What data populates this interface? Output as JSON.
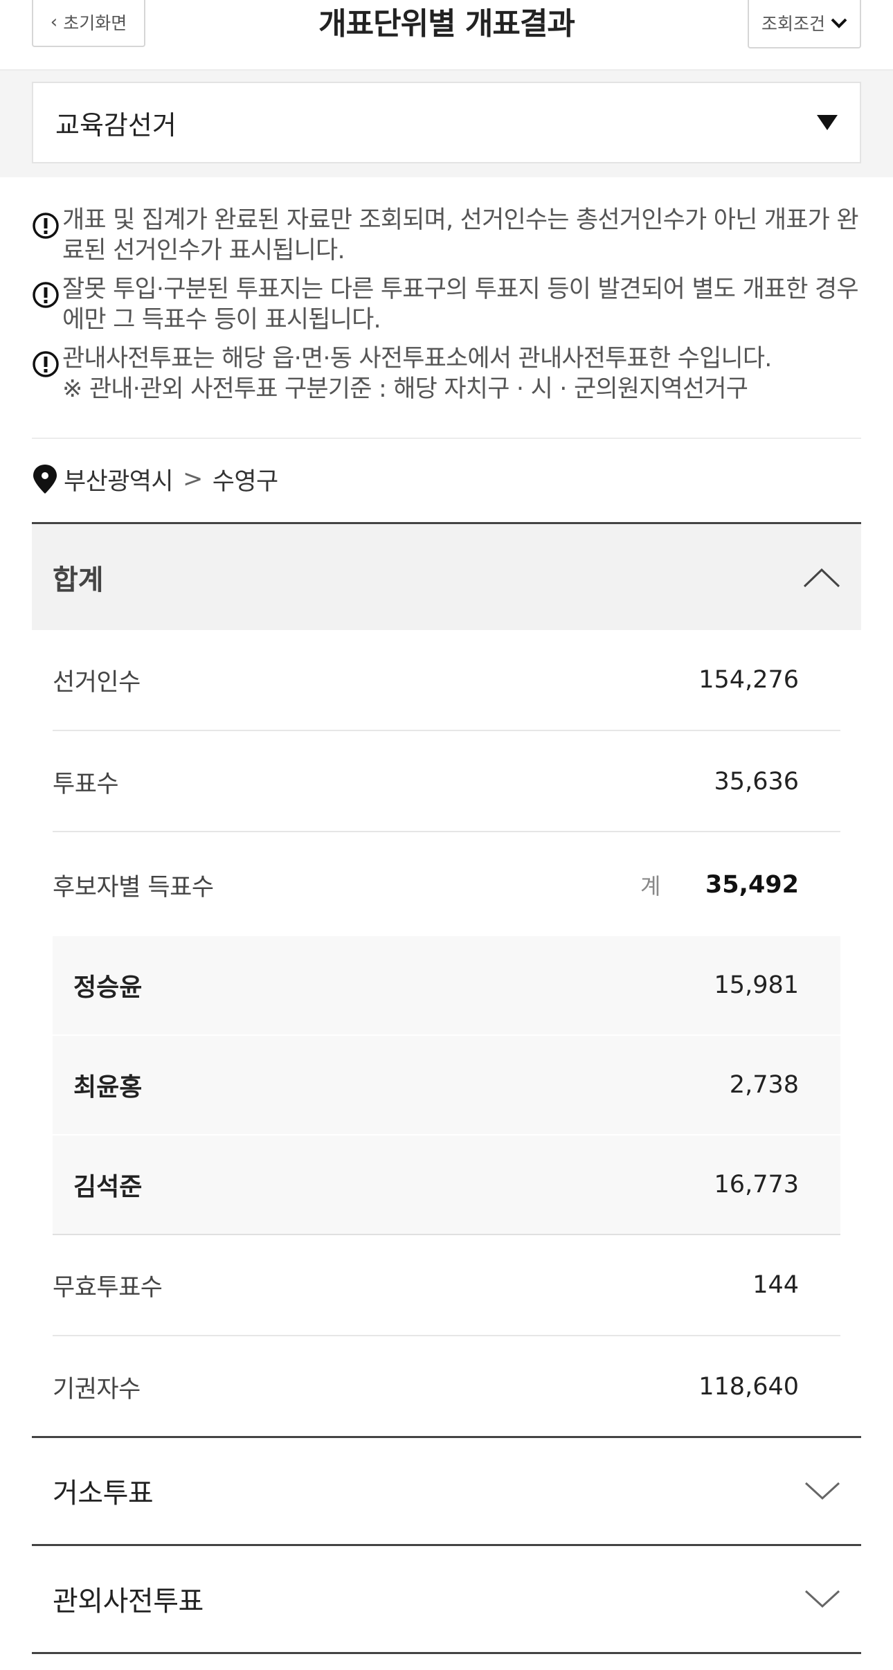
{
  "header": {
    "back_label": "초기화면",
    "title": "개표단위별 개표결과",
    "condition_label": "조회조건"
  },
  "election_select": {
    "selected": "교육감선거"
  },
  "notices": [
    "개표 및 집계가 완료된 자료만 조회되며, 선거인수는 총선거인수가 아닌 개표가 완료된 선거인수가 표시됩니다.",
    "잘못 투입·구분된 투표지는 다른 투표구의 투표지 등이 발견되어 별도 개표한 경우에만 그 득표수 등이 표시됩니다.",
    "관내사전투표는 해당 읍·면·동 사전투표소에서 관내사전투표한 수입니다.\n※ 관내·관외 사전투표 구분기준 : 해당 자치구 · 시 · 군의원지역선거구"
  ],
  "breadcrumb": {
    "region": "부산광역시",
    "separator": ">",
    "district": "수영구"
  },
  "total_section": {
    "title": "합계",
    "voters_label": "선거인수",
    "voters_value": "154,276",
    "votes_label": "투표수",
    "votes_value": "35,636",
    "candidate_votes_label": "후보자별 득표수",
    "sum_label": "계",
    "sum_value": "35,492",
    "candidates": [
      {
        "name": "정승윤",
        "votes": "15,981"
      },
      {
        "name": "최윤홍",
        "votes": "2,738"
      },
      {
        "name": "김석준",
        "votes": "16,773"
      }
    ],
    "invalid_label": "무효투표수",
    "invalid_value": "144",
    "abstain_label": "기권자수",
    "abstain_value": "118,640"
  },
  "sections": [
    {
      "title": "거소투표"
    },
    {
      "title": "관외사전투표"
    }
  ],
  "colors": {
    "border_dark": "#444444",
    "panel_bg": "#f2f2f2",
    "band_bg": "#f4f4f4"
  }
}
